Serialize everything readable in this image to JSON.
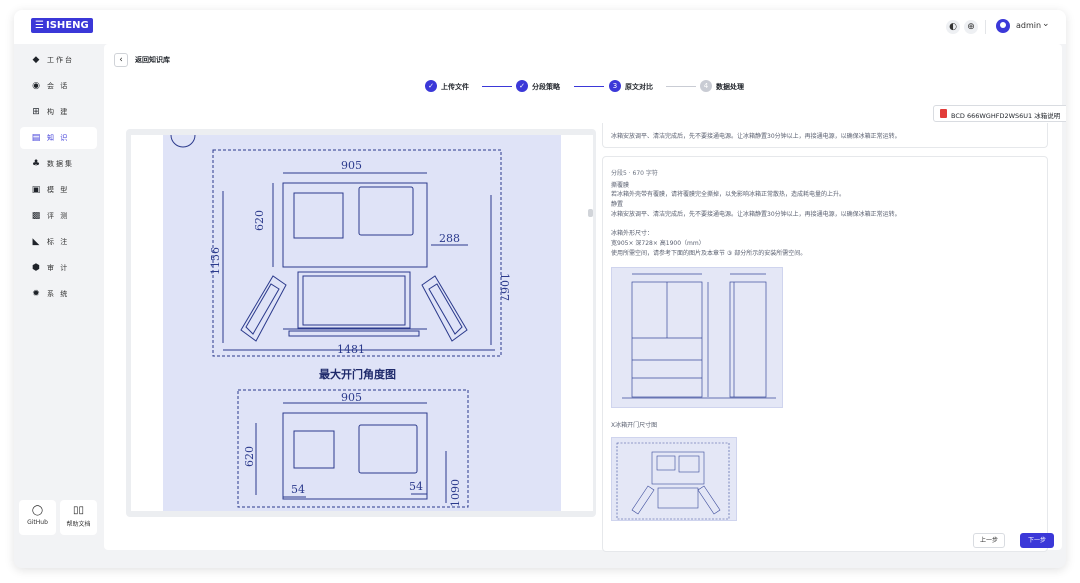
{
  "app": {
    "logo": "ISHENG",
    "user": "admin"
  },
  "topbar": {
    "icon_theme": "theme-icon",
    "icon_lang": "globe-icon"
  },
  "sidebar": {
    "items": [
      {
        "label": "工作台",
        "icon": "cube-icon"
      },
      {
        "label": "会 话",
        "icon": "chat-icon"
      },
      {
        "label": "构 建",
        "icon": "build-icon"
      },
      {
        "label": "知 识",
        "icon": "book-icon",
        "active": true
      },
      {
        "label": "数据集",
        "icon": "dataset-icon"
      },
      {
        "label": "模 型",
        "icon": "model-icon"
      },
      {
        "label": "评 测",
        "icon": "eval-icon"
      },
      {
        "label": "标 注",
        "icon": "tag-icon"
      },
      {
        "label": "审 计",
        "icon": "audit-icon"
      },
      {
        "label": "系 统",
        "icon": "gear-icon"
      }
    ],
    "github": "GitHub",
    "help": "帮助文档"
  },
  "header": {
    "back_label": "返回知识库"
  },
  "steps": [
    {
      "label": "上传文件",
      "state": "done",
      "num": "✓"
    },
    {
      "label": "分段策略",
      "state": "done",
      "num": "✓"
    },
    {
      "label": "原文对比",
      "state": "current",
      "num": "3"
    },
    {
      "label": "数据处理",
      "state": "pending",
      "num": "4"
    }
  ],
  "doc_select": {
    "value": "BCD 666WGHFD2WS6U1 冰箱说明"
  },
  "preview": {
    "dim_905_top": "905",
    "dim_620_top": "620",
    "dim_288": "288",
    "dim_1156": "1156",
    "dim_1067": "1067",
    "dim_1481": "1481",
    "section_title": "最大开门角度图",
    "dim_905_bottom": "905",
    "dim_620_bottom": "620",
    "dim_54_left": "54",
    "dim_54_right": "54",
    "dim_1090": "1090"
  },
  "segments": {
    "top_text": "冰箱安放调平、清洁完成后，先不要接通电源。让冰箱静置30分钟以上，再接通电源，以确保冰箱正常运转。",
    "title": "分段5 · 670 字符",
    "lines": [
      "撕覆膜",
      "若冰箱外壳带有覆膜，请将覆膜完全撕掉，以免影响冰箱正常散热，造成耗电量的上升。",
      "静置",
      "冰箱安放调平、清洁完成后，先不要接通电源。让冰箱静置30分钟以上，再接通电源，以确保冰箱正常运转。",
      "",
      "冰箱外形尺寸：",
      "宽905× 深728× 高1900（mm）",
      "使用所需空间，请参考下面的图片及本章节 ③ 部分所示的安装所需空间。"
    ],
    "image_caption": "X冰箱开门尺寸图"
  },
  "footer": {
    "prev": "上一步",
    "next": "下一步"
  },
  "colors": {
    "accent": "#3b38d8",
    "drawing_blue": "#dfe3f7",
    "line": "#2b3a8c"
  }
}
